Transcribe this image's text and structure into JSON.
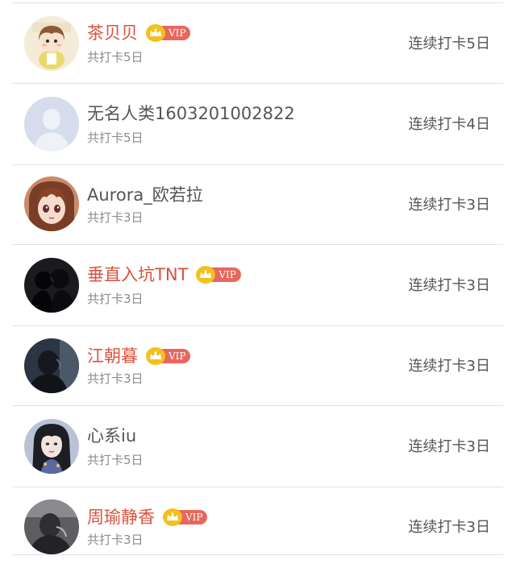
{
  "checkin_list": [
    {
      "name": "茶贝贝",
      "vip": true,
      "vip_label": "VIP",
      "total": "共打卡5日",
      "streak": "连续打卡5日",
      "avatar_icon": "avatar-cartoon-girl-icon"
    },
    {
      "name": "无名人类1603201002822",
      "vip": false,
      "total": "共打卡5日",
      "streak": "连续打卡4日",
      "avatar_icon": "avatar-default-user-icon"
    },
    {
      "name": "Aurora_欧若拉",
      "vip": false,
      "total": "共打卡3日",
      "streak": "连续打卡3日",
      "avatar_icon": "avatar-anime-girl-icon"
    },
    {
      "name": "垂直入坑TNT",
      "vip": true,
      "vip_label": "VIP",
      "total": "共打卡3日",
      "streak": "连续打卡3日",
      "avatar_icon": "avatar-silhouette-couple-icon"
    },
    {
      "name": "江朝暮",
      "vip": true,
      "vip_label": "VIP",
      "total": "共打卡3日",
      "streak": "连续打卡3日",
      "avatar_icon": "avatar-dark-portrait-icon"
    },
    {
      "name": "心系iu",
      "vip": false,
      "total": "共打卡5日",
      "streak": "连续打卡3日",
      "avatar_icon": "avatar-photo-woman-icon"
    },
    {
      "name": "周瑜静香",
      "vip": true,
      "vip_label": "VIP",
      "total": "共打卡3日",
      "streak": "连续打卡3日",
      "avatar_icon": "avatar-gray-portrait-icon"
    }
  ],
  "colors": {
    "vip_name": "#d9533f",
    "normal_name": "#555555",
    "secondary_text": "#8c8c8c",
    "vip_crown": "#f2c11d",
    "vip_pill": "#e8675d",
    "divider": "#e2e2e2"
  }
}
